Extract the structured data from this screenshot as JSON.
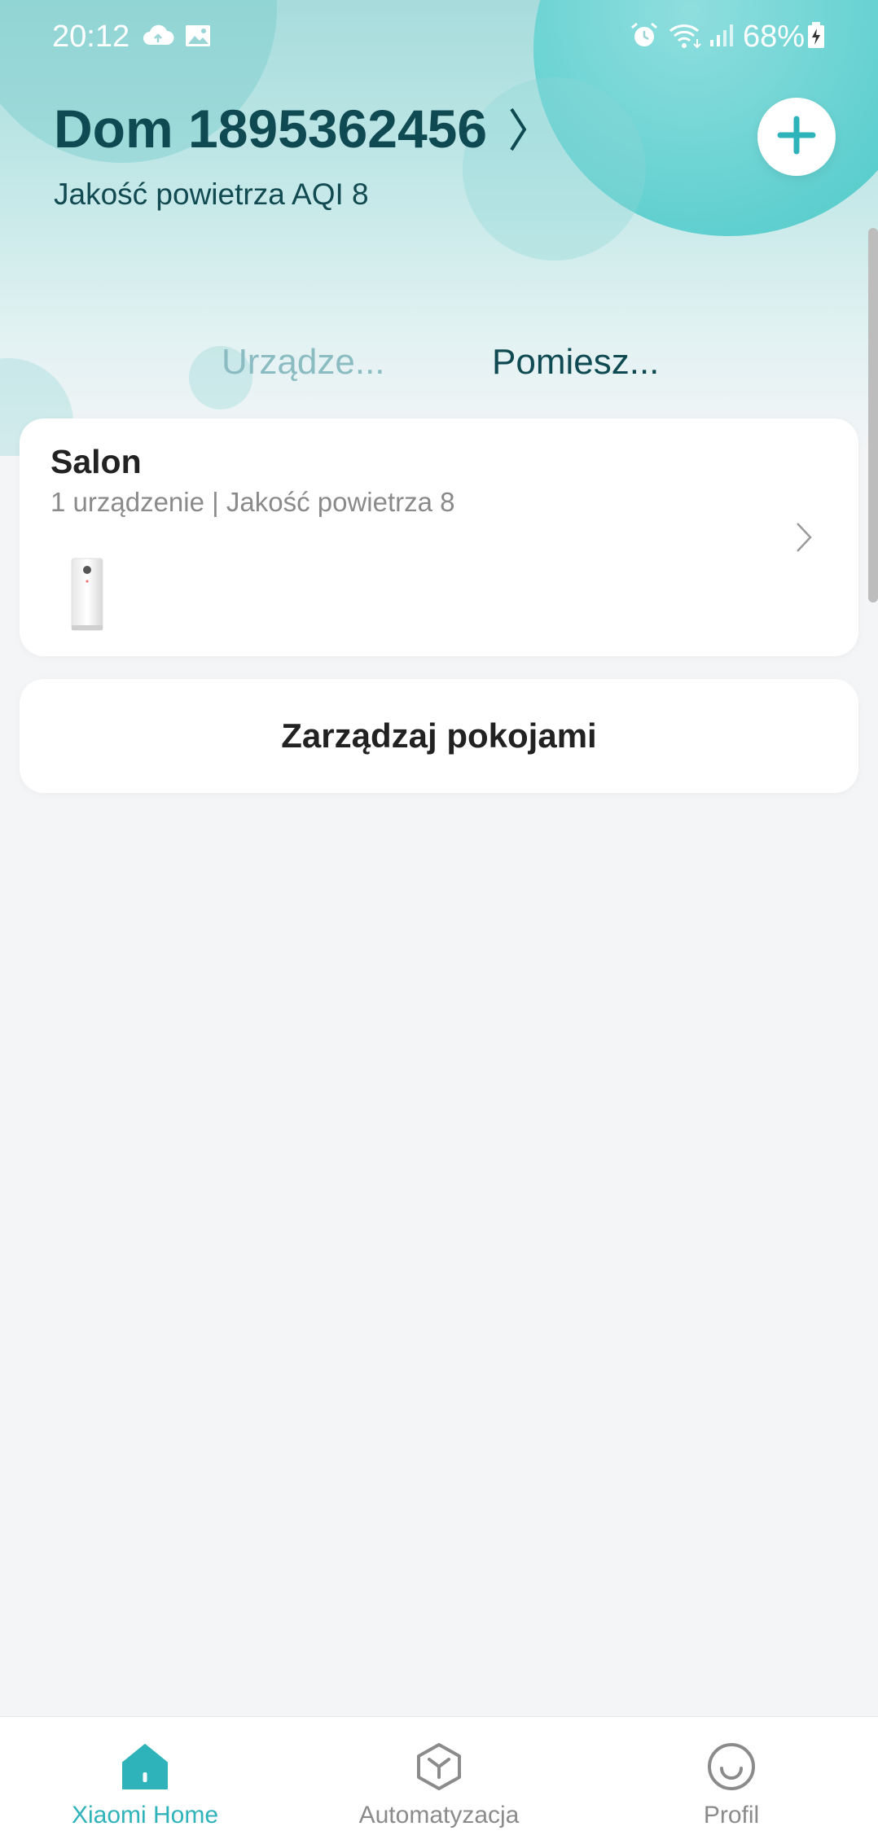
{
  "status_bar": {
    "time": "20:12",
    "battery": "68%",
    "left_icons": [
      "cloud-sync-icon",
      "image-icon"
    ],
    "right_icons": [
      "alarm-icon",
      "wifi-icon",
      "signal-icon",
      "battery-charging-icon"
    ]
  },
  "header": {
    "home_name": "Dom 1895362456",
    "air_quality": "Jakość powietrza AQI 8",
    "add_icon": "plus-icon"
  },
  "tabs": [
    {
      "label": "Urządze...",
      "active": false
    },
    {
      "label": "Pomiesz...",
      "active": true
    }
  ],
  "rooms": [
    {
      "name": "Salon",
      "subtitle": "1 urządzenie | Jakość powietrza 8",
      "device_icon": "air-purifier-icon"
    }
  ],
  "manage_rooms_label": "Zarządzaj pokojami",
  "bottom_nav": [
    {
      "label": "Xiaomi Home",
      "icon": "home-icon",
      "active": true
    },
    {
      "label": "Automatyzacja",
      "icon": "automation-cube-icon",
      "active": false
    },
    {
      "label": "Profil",
      "icon": "smile-face-icon",
      "active": false
    }
  ],
  "colors": {
    "accent": "#2fb3ba",
    "header_text": "#0f4a52",
    "background": "#f4f5f7"
  }
}
